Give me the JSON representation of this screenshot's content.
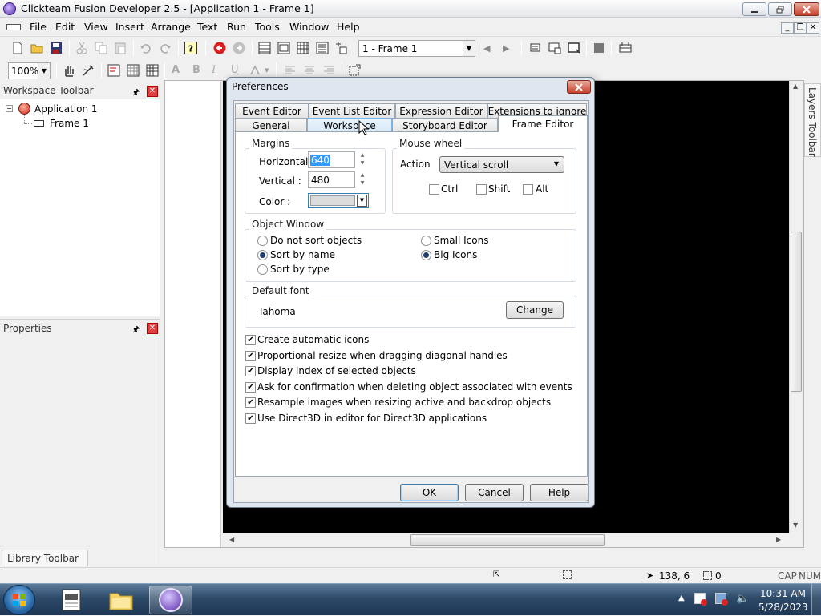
{
  "window": {
    "title": "Clickteam Fusion Developer 2.5 - [Application 1 - Frame 1]"
  },
  "menu": [
    "File",
    "Edit",
    "View",
    "Insert",
    "Arrange",
    "Text",
    "Run",
    "Tools",
    "Window",
    "Help"
  ],
  "toolbar": {
    "frame_select": "1 - Frame 1",
    "zoom": "100%"
  },
  "workspace": {
    "title": "Workspace Toolbar",
    "tree": [
      {
        "label": "Application 1"
      },
      {
        "label": "Frame 1"
      }
    ]
  },
  "properties": {
    "title": "Properties"
  },
  "library": {
    "title": "Library Toolbar"
  },
  "layers": {
    "title": "Layers Toolbar"
  },
  "dialog": {
    "title": "Preferences",
    "tabs_back": [
      "Event Editor",
      "Event List Editor",
      "Expression Editor",
      "Extensions to ignore"
    ],
    "tabs_front": [
      "General",
      "Workspace",
      "Storyboard Editor",
      "Frame Editor"
    ],
    "active_tab": "Frame Editor",
    "margins": {
      "label": "Margins",
      "horizontal_label": "Horizontal :",
      "horizontal_value": "640",
      "vertical_label": "Vertical :",
      "vertical_value": "480",
      "color_label": "Color :"
    },
    "mouse_wheel": {
      "label": "Mouse wheel",
      "action_label": "Action",
      "action_value": "Vertical scroll",
      "ctrl": "Ctrl",
      "shift": "Shift",
      "alt": "Alt"
    },
    "object_window": {
      "label": "Object Window",
      "options": [
        {
          "label": "Do not sort objects",
          "checked": false
        },
        {
          "label": "Sort by name",
          "checked": true
        },
        {
          "label": "Sort by type",
          "checked": false
        },
        {
          "label": "Small Icons",
          "checked": false
        },
        {
          "label": "Big Icons",
          "checked": true
        }
      ]
    },
    "default_font": {
      "label": "Default font",
      "value": "Tahoma",
      "change_button": "Change"
    },
    "checkboxes": [
      {
        "label": "Create automatic icons",
        "checked": true
      },
      {
        "label": "Proportional resize when dragging diagonal handles",
        "checked": true
      },
      {
        "label": "Display index of selected objects",
        "checked": true
      },
      {
        "label": "Ask for confirmation when deleting object associated with events",
        "checked": true
      },
      {
        "label": "Resample images when resizing active and backdrop objects",
        "checked": true
      },
      {
        "label": "Use Direct3D in editor for Direct3D applications",
        "checked": true
      }
    ],
    "buttons": {
      "ok": "OK",
      "cancel": "Cancel",
      "help": "Help"
    }
  },
  "statusbar": {
    "coords": "138, 6",
    "objects": "0",
    "caps": "CAP",
    "num": "NUM"
  },
  "taskbar": {
    "time": "10:31 AM",
    "date": "5/28/2023"
  },
  "colors": {
    "frame_bg": "#000000",
    "dialog_frame": "#dfe6ef",
    "accent": "#3399ff"
  }
}
